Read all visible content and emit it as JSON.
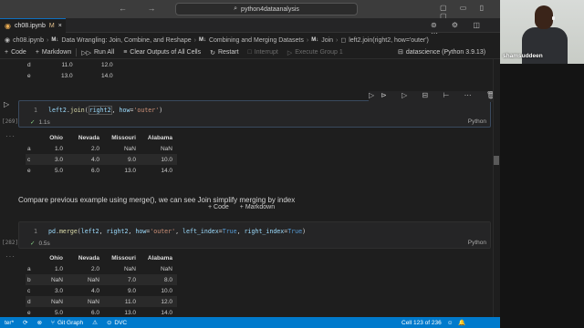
{
  "titlebar": {
    "search_text": "python4dataanalysis",
    "nav_icons": "← →",
    "window_icons": "▢ ▭ ▯ ▢"
  },
  "tab": {
    "filename": "ch08.ipynb",
    "modified_marker": "M",
    "close": "×"
  },
  "breadcrumb": {
    "file": "ch08.ipynb",
    "section1": "Data Wrangling: Join, Combine, and Reshape",
    "section2": "Combining and Merging Datasets",
    "section3": "Join",
    "section4": "left2.join(right2, how='outer')",
    "md_marker": "M↓"
  },
  "toolbar": {
    "code": "Code",
    "markdown": "Markdown",
    "run_all": "Run All",
    "clear_outputs": "Clear Outputs of All Cells",
    "restart": "Restart",
    "interrupt": "Interrupt",
    "execute_group": "Execute Group 1",
    "kernel": "datascience (Python 3.9.13)"
  },
  "prev_output": {
    "rows": [
      {
        "idx": "d",
        "a": "11.0",
        "b": "12.0"
      },
      {
        "idx": "e",
        "a": "13.0",
        "b": "14.0"
      }
    ]
  },
  "cell1": {
    "exec": "[269]",
    "line_no": "1",
    "code_text": "left2.join(right2, how='outer')",
    "time": "1.1s",
    "lang": "Python"
  },
  "table1": {
    "headers": [
      "",
      "Ohio",
      "Nevada",
      "Missouri",
      "Alabama"
    ],
    "rows": [
      [
        "a",
        "1.0",
        "2.0",
        "NaN",
        "NaN"
      ],
      [
        "c",
        "3.0",
        "4.0",
        "9.0",
        "10.0"
      ],
      [
        "e",
        "5.0",
        "6.0",
        "13.0",
        "14.0"
      ]
    ]
  },
  "markdown_cell": {
    "text": "Compare previous example using merge(), we can see Join simplify merging by index"
  },
  "add_bar": {
    "code": "+ Code",
    "markdown": "+ Markdown"
  },
  "cell2": {
    "exec": "[282]",
    "line_no": "1",
    "code_text": "pd.merge(left2, right2, how='outer', left_index=True, right_index=True)",
    "time": "0.5s",
    "lang": "Python"
  },
  "table2": {
    "headers": [
      "",
      "Ohio",
      "Nevada",
      "Missouri",
      "Alabama"
    ],
    "rows": [
      [
        "a",
        "1.0",
        "2.0",
        "NaN",
        "NaN"
      ],
      [
        "b",
        "NaN",
        "NaN",
        "7.0",
        "8.0"
      ],
      [
        "c",
        "3.0",
        "4.0",
        "9.0",
        "10.0"
      ],
      [
        "d",
        "NaN",
        "NaN",
        "11.0",
        "12.0"
      ],
      [
        "e",
        "5.0",
        "6.0",
        "13.0",
        "14.0"
      ]
    ]
  },
  "statusbar": {
    "left_label": "ter*",
    "git_graph": "Git Graph",
    "dvc": "DVC",
    "cell_pos": "Cell 123 of 236"
  },
  "webcam": {
    "name": "shamsuddeen"
  },
  "colors": {
    "statusbar": "#007acc",
    "editor_bg": "#1e1e1e",
    "cell_bg": "#252526",
    "check": "#89d185"
  }
}
